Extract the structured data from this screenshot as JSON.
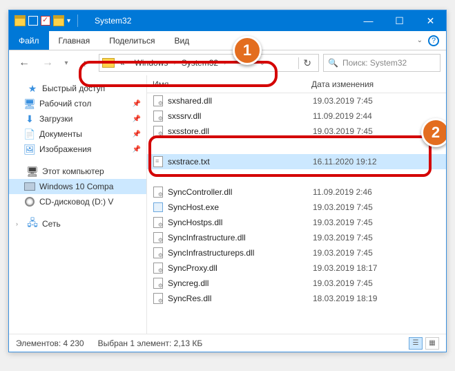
{
  "window": {
    "title": "System32"
  },
  "ribbon": {
    "file": "Файл",
    "tabs": [
      "Главная",
      "Поделиться",
      "Вид"
    ]
  },
  "address": {
    "prefix": "«",
    "crumbs": [
      "Windows",
      "System32"
    ]
  },
  "search": {
    "placeholder": "Поиск: System32"
  },
  "sidebar": {
    "quick": {
      "label": "Быстрый доступ",
      "items": [
        {
          "label": "Рабочий стол",
          "pin": true
        },
        {
          "label": "Загрузки",
          "pin": true
        },
        {
          "label": "Документы",
          "pin": true
        },
        {
          "label": "Изображения",
          "pin": true
        }
      ]
    },
    "pc": {
      "label": "Этот компьютер",
      "items": [
        {
          "label": "Windows 10 Compa",
          "selected": true
        },
        {
          "label": "CD-дисковод (D:) V"
        }
      ]
    },
    "net": {
      "label": "Сеть"
    }
  },
  "columns": {
    "name": "Имя",
    "date": "Дата изменения"
  },
  "files": [
    {
      "name": "sxshared.dll",
      "date": "19.03.2019 7:45",
      "type": "dll"
    },
    {
      "name": "sxssrv.dll",
      "date": "11.09.2019 2:44",
      "type": "dll"
    },
    {
      "name": "sxsstore.dll",
      "date": "19.03.2019 7:45",
      "type": "dll"
    },
    {
      "name": "",
      "date": "",
      "type": "blank"
    },
    {
      "name": "sxstrace.txt",
      "date": "16.11.2020 19:12",
      "type": "txt",
      "selected": true
    },
    {
      "name": "",
      "date": "",
      "type": "blank"
    },
    {
      "name": "SyncController.dll",
      "date": "11.09.2019 2:46",
      "type": "dll"
    },
    {
      "name": "SyncHost.exe",
      "date": "19.03.2019 7:45",
      "type": "exe"
    },
    {
      "name": "SyncHostps.dll",
      "date": "19.03.2019 7:45",
      "type": "dll"
    },
    {
      "name": "SyncInfrastructure.dll",
      "date": "19.03.2019 7:45",
      "type": "dll"
    },
    {
      "name": "SyncInfrastructureps.dll",
      "date": "19.03.2019 7:45",
      "type": "dll"
    },
    {
      "name": "SyncProxy.dll",
      "date": "19.03.2019 18:17",
      "type": "dll"
    },
    {
      "name": "Syncreg.dll",
      "date": "19.03.2019 7:45",
      "type": "dll"
    },
    {
      "name": "SyncRes.dll",
      "date": "18.03.2019 18:19",
      "type": "dll"
    }
  ],
  "status": {
    "elements_label": "Элементов:",
    "elements_count": "4 230",
    "selected_label": "Выбран 1 элемент:",
    "selected_size": "2,13 КБ"
  },
  "annotations": {
    "b1": "1",
    "b2": "2"
  }
}
